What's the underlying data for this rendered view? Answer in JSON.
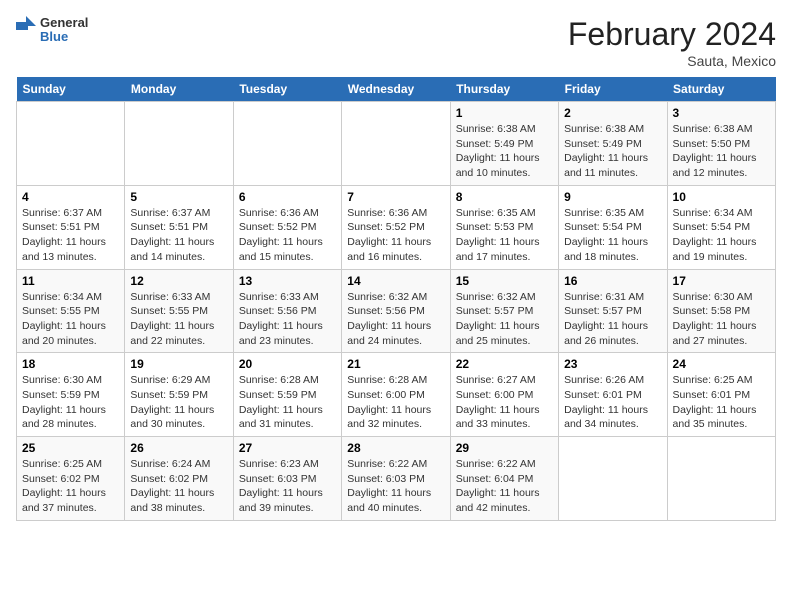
{
  "header": {
    "logo_general": "General",
    "logo_blue": "Blue",
    "title": "February 2024",
    "subtitle": "Sauta, Mexico"
  },
  "days_of_week": [
    "Sunday",
    "Monday",
    "Tuesday",
    "Wednesday",
    "Thursday",
    "Friday",
    "Saturday"
  ],
  "weeks": [
    [
      {
        "day": "",
        "info": ""
      },
      {
        "day": "",
        "info": ""
      },
      {
        "day": "",
        "info": ""
      },
      {
        "day": "",
        "info": ""
      },
      {
        "day": "1",
        "info": "Sunrise: 6:38 AM\nSunset: 5:49 PM\nDaylight: 11 hours and 10 minutes."
      },
      {
        "day": "2",
        "info": "Sunrise: 6:38 AM\nSunset: 5:49 PM\nDaylight: 11 hours and 11 minutes."
      },
      {
        "day": "3",
        "info": "Sunrise: 6:38 AM\nSunset: 5:50 PM\nDaylight: 11 hours and 12 minutes."
      }
    ],
    [
      {
        "day": "4",
        "info": "Sunrise: 6:37 AM\nSunset: 5:51 PM\nDaylight: 11 hours and 13 minutes."
      },
      {
        "day": "5",
        "info": "Sunrise: 6:37 AM\nSunset: 5:51 PM\nDaylight: 11 hours and 14 minutes."
      },
      {
        "day": "6",
        "info": "Sunrise: 6:36 AM\nSunset: 5:52 PM\nDaylight: 11 hours and 15 minutes."
      },
      {
        "day": "7",
        "info": "Sunrise: 6:36 AM\nSunset: 5:52 PM\nDaylight: 11 hours and 16 minutes."
      },
      {
        "day": "8",
        "info": "Sunrise: 6:35 AM\nSunset: 5:53 PM\nDaylight: 11 hours and 17 minutes."
      },
      {
        "day": "9",
        "info": "Sunrise: 6:35 AM\nSunset: 5:54 PM\nDaylight: 11 hours and 18 minutes."
      },
      {
        "day": "10",
        "info": "Sunrise: 6:34 AM\nSunset: 5:54 PM\nDaylight: 11 hours and 19 minutes."
      }
    ],
    [
      {
        "day": "11",
        "info": "Sunrise: 6:34 AM\nSunset: 5:55 PM\nDaylight: 11 hours and 20 minutes."
      },
      {
        "day": "12",
        "info": "Sunrise: 6:33 AM\nSunset: 5:55 PM\nDaylight: 11 hours and 22 minutes."
      },
      {
        "day": "13",
        "info": "Sunrise: 6:33 AM\nSunset: 5:56 PM\nDaylight: 11 hours and 23 minutes."
      },
      {
        "day": "14",
        "info": "Sunrise: 6:32 AM\nSunset: 5:56 PM\nDaylight: 11 hours and 24 minutes."
      },
      {
        "day": "15",
        "info": "Sunrise: 6:32 AM\nSunset: 5:57 PM\nDaylight: 11 hours and 25 minutes."
      },
      {
        "day": "16",
        "info": "Sunrise: 6:31 AM\nSunset: 5:57 PM\nDaylight: 11 hours and 26 minutes."
      },
      {
        "day": "17",
        "info": "Sunrise: 6:30 AM\nSunset: 5:58 PM\nDaylight: 11 hours and 27 minutes."
      }
    ],
    [
      {
        "day": "18",
        "info": "Sunrise: 6:30 AM\nSunset: 5:59 PM\nDaylight: 11 hours and 28 minutes."
      },
      {
        "day": "19",
        "info": "Sunrise: 6:29 AM\nSunset: 5:59 PM\nDaylight: 11 hours and 30 minutes."
      },
      {
        "day": "20",
        "info": "Sunrise: 6:28 AM\nSunset: 5:59 PM\nDaylight: 11 hours and 31 minutes."
      },
      {
        "day": "21",
        "info": "Sunrise: 6:28 AM\nSunset: 6:00 PM\nDaylight: 11 hours and 32 minutes."
      },
      {
        "day": "22",
        "info": "Sunrise: 6:27 AM\nSunset: 6:00 PM\nDaylight: 11 hours and 33 minutes."
      },
      {
        "day": "23",
        "info": "Sunrise: 6:26 AM\nSunset: 6:01 PM\nDaylight: 11 hours and 34 minutes."
      },
      {
        "day": "24",
        "info": "Sunrise: 6:25 AM\nSunset: 6:01 PM\nDaylight: 11 hours and 35 minutes."
      }
    ],
    [
      {
        "day": "25",
        "info": "Sunrise: 6:25 AM\nSunset: 6:02 PM\nDaylight: 11 hours and 37 minutes."
      },
      {
        "day": "26",
        "info": "Sunrise: 6:24 AM\nSunset: 6:02 PM\nDaylight: 11 hours and 38 minutes."
      },
      {
        "day": "27",
        "info": "Sunrise: 6:23 AM\nSunset: 6:03 PM\nDaylight: 11 hours and 39 minutes."
      },
      {
        "day": "28",
        "info": "Sunrise: 6:22 AM\nSunset: 6:03 PM\nDaylight: 11 hours and 40 minutes."
      },
      {
        "day": "29",
        "info": "Sunrise: 6:22 AM\nSunset: 6:04 PM\nDaylight: 11 hours and 42 minutes."
      },
      {
        "day": "",
        "info": ""
      },
      {
        "day": "",
        "info": ""
      }
    ]
  ]
}
